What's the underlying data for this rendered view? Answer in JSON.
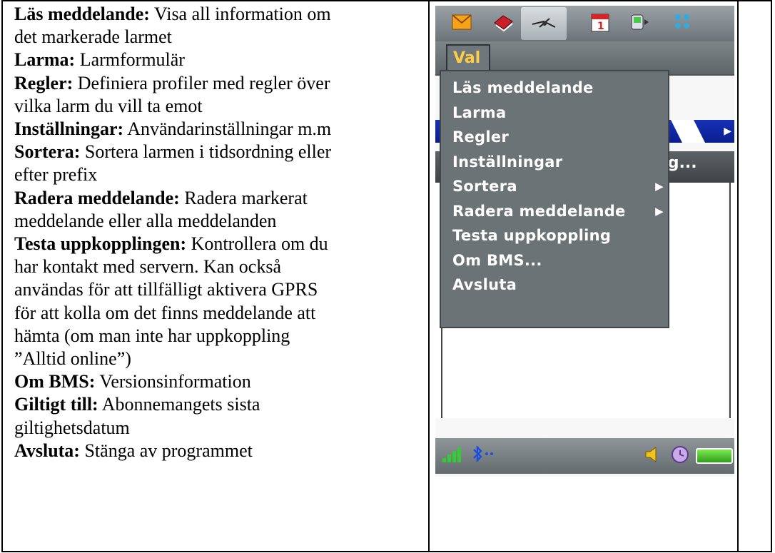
{
  "descriptions": [
    {
      "term": "Läs meddelande:",
      "text": " Visa all information om",
      "cont": [
        "det markerade larmet"
      ]
    },
    {
      "term": "Larma:",
      "text": " Larmformulär",
      "cont": []
    },
    {
      "term": "Regler:",
      "text": " Definiera profiler med regler över",
      "cont": [
        "vilka larm du vill ta emot"
      ]
    },
    {
      "term": "Inställningar:",
      "text": " Användarinställningar m.m",
      "cont": []
    },
    {
      "term": "Sortera:",
      "text": " Sortera larmen i tidsordning eller",
      "cont": [
        "efter prefix"
      ]
    },
    {
      "term": "Radera meddelande:",
      "text": " Radera markerat",
      "cont": [
        "meddelande eller alla meddelanden"
      ]
    },
    {
      "term": "Testa uppkopplingen:",
      "text": " Kontrollera om du",
      "cont": [
        "har kontakt med servern. Kan också",
        "användas för att tillfälligt aktivera GPRS",
        "för att kolla om det finns meddelande att",
        "hämta (om man inte har uppkoppling",
        "”Alltid online”)"
      ]
    },
    {
      "term": "Om BMS:",
      "text": " Versionsinformation",
      "cont": []
    },
    {
      "term": "Giltigt till:",
      "text": " Abonnemangets sista",
      "cont": [
        "giltighetsdatum"
      ]
    },
    {
      "term": "Avsluta:",
      "text": " Stänga av programmet",
      "cont": []
    }
  ],
  "phone": {
    "toolbar_icons": [
      "mail-icon",
      "book-icon",
      "satellite-icon",
      "calendar-icon",
      "phone-icon",
      "apps-grid-icon"
    ],
    "menu_tab": "Val",
    "clipped_row_text": "erg...",
    "menu_items": [
      {
        "label": "Läs meddelande",
        "submenu": false
      },
      {
        "label": "Larma",
        "submenu": false
      },
      {
        "label": "Regler",
        "submenu": false
      },
      {
        "label": "Inställningar",
        "submenu": false
      },
      {
        "label": "Sortera",
        "submenu": true
      },
      {
        "label": "Radera meddelande",
        "submenu": true
      },
      {
        "label": "Testa uppkoppling",
        "submenu": false
      },
      {
        "label": "Om BMS...",
        "submenu": false
      },
      {
        "label": "Avsluta",
        "submenu": false
      }
    ],
    "status_icons": [
      "signal-icon",
      "bluetooth-icon",
      "volume-icon",
      "clock-icon",
      "battery-icon"
    ],
    "colors": {
      "menu_bg": "#6b7377",
      "menu_text": "#ffffff",
      "tab_text": "#ffcc44",
      "blue_bar": "#1730b6"
    }
  }
}
